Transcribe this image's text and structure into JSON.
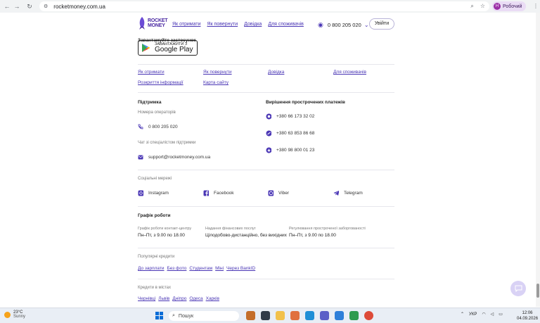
{
  "browser": {
    "url": "rocketmoney.com.ua",
    "profile_initial": "Н",
    "profile_label": "Робочий"
  },
  "header": {
    "logo_line1": "ROCKET",
    "logo_line2": "MONEY",
    "nav": [
      "Як отримати",
      "Як повернути",
      "Довідка",
      "Для споживачів"
    ],
    "phone": "0 800 205 020",
    "login": "Увійти"
  },
  "app": {
    "title": "Завантажуйте застосунок",
    "gp_small": "ЗАВАНТАЖИТИ З",
    "gp_big": "Google Play"
  },
  "footer_links": {
    "row1": [
      "Як отримати",
      "Як повернути",
      "Довідка",
      "Для споживачів"
    ],
    "row2": [
      "Розкриття інформації",
      "Карта сайту"
    ]
  },
  "support": {
    "title": "Підтримка",
    "operators_label": "Номера операторів",
    "phone": "0 800 205 020",
    "chat_label": "Чат зі спеціалістом підтримки",
    "email": "support@rocketmoney.com.ua"
  },
  "overdue": {
    "title": "Вирішення прострочених платежів",
    "phones": [
      "+380 66 173 32 02",
      "+380 63 853 86 68",
      "+380 98 800 01 23"
    ]
  },
  "social": {
    "title": "Соціальні мережі",
    "items": [
      "Instagram",
      "Facebook",
      "Viber",
      "Telegram"
    ]
  },
  "schedule": {
    "title": "Графік роботи",
    "cols": [
      {
        "label": "Графік роботи контакт-центру",
        "value": "Пн–Пт, з 9.00 по 18.00"
      },
      {
        "label": "Надання фінансових послуг",
        "value": "Цілодобово-дистанційно, без вихідних"
      },
      {
        "label": "Регулювання простроченої заборгованості",
        "value": "Пн–Пт, з 9.00 по 18.00"
      }
    ]
  },
  "popular": {
    "title": "Популярні кредити",
    "items": [
      "До зарплати",
      "Без фото",
      "Студентам",
      "Міні",
      "Через BankID"
    ]
  },
  "cities": {
    "title": "Кредити в містах",
    "items": [
      "Чернівці",
      "Львів",
      "Дніпро",
      "Одеса",
      "Харків"
    ]
  },
  "taskbar": {
    "temp": "23°C",
    "weather": "Sunny",
    "search": "Пошук",
    "lang": "УКР",
    "time": "12:06",
    "date": "04.09.2026"
  }
}
